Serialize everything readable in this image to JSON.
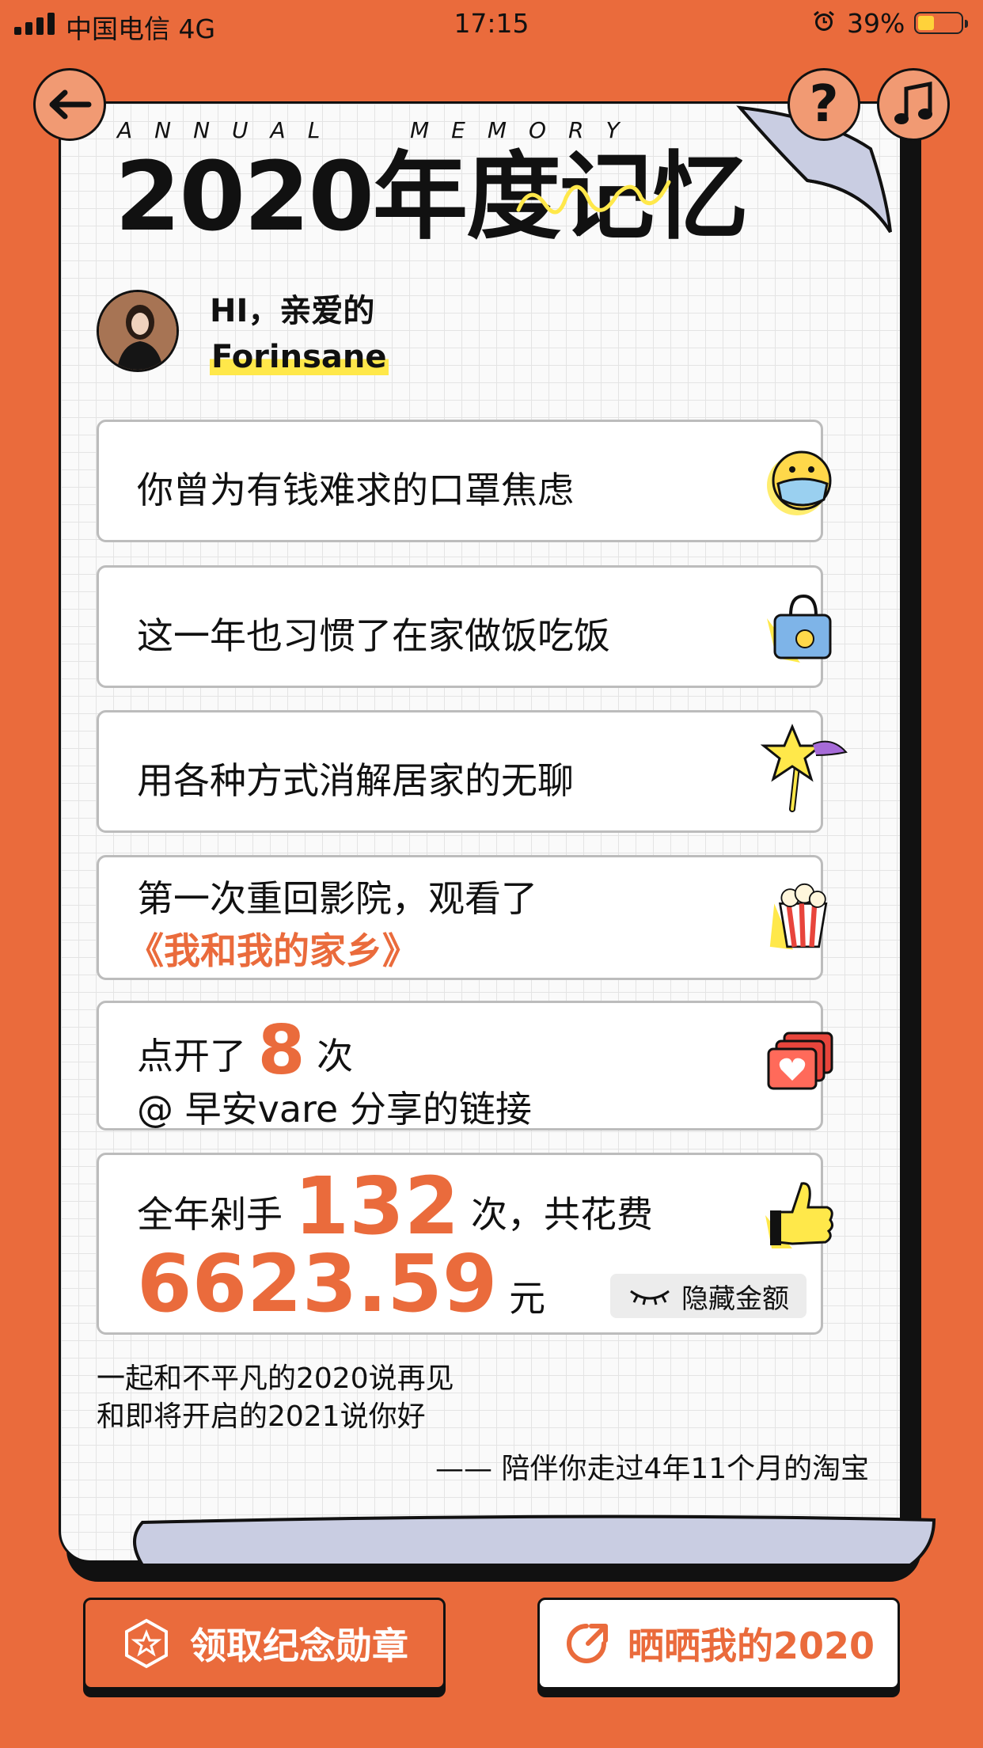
{
  "status_bar": {
    "carrier": "中国电信 4G",
    "time": "17:15",
    "battery_percent": "39%",
    "battery_level": 0.39
  },
  "header": {
    "back_icon": "arrow-left-icon",
    "help_label": "?",
    "music_icon": "music-note-icon"
  },
  "paper": {
    "annual_left": "ANNUAL",
    "annual_right": "MEMORY",
    "title": "2020年度记忆",
    "greeting": "HI，亲爱的",
    "username": "Forinsane"
  },
  "cards": [
    {
      "text": "你曾为有钱难求的口罩焦虑",
      "icon": "mask-face-icon"
    },
    {
      "text": "这一年也习惯了在家做饭吃饭",
      "icon": "lunch-bag-icon"
    },
    {
      "text": "用各种方式消解居家的无聊",
      "icon": "magic-wand-star-icon"
    },
    {
      "line1": "第一次重回影院，观看了",
      "movie": "《我和我的家乡》",
      "icon": "popcorn-icon"
    },
    {
      "prefix": "点开了",
      "count": "8",
      "suffix": "次",
      "line2": "@ 早安vare 分享的链接",
      "icon": "heart-message-icon"
    },
    {
      "prefix": "全年剁手",
      "count": "132",
      "suffix": "次，共花费",
      "amount": "6623.59",
      "unit": "元",
      "hide_label": "隐藏金额",
      "icon": "thumbs-up-icon"
    }
  ],
  "closing": {
    "line1": "一起和不平凡的2020说再见",
    "line2": "和即将开启的2021说你好",
    "signoff": "—— 陪伴你走过4年11个月的淘宝"
  },
  "buttons": {
    "medal": "领取纪念勋章",
    "share": "晒晒我的2020"
  },
  "colors": {
    "background": "#ea6b3c",
    "accent": "#ea6b3c",
    "highlight": "#ffe84a"
  }
}
